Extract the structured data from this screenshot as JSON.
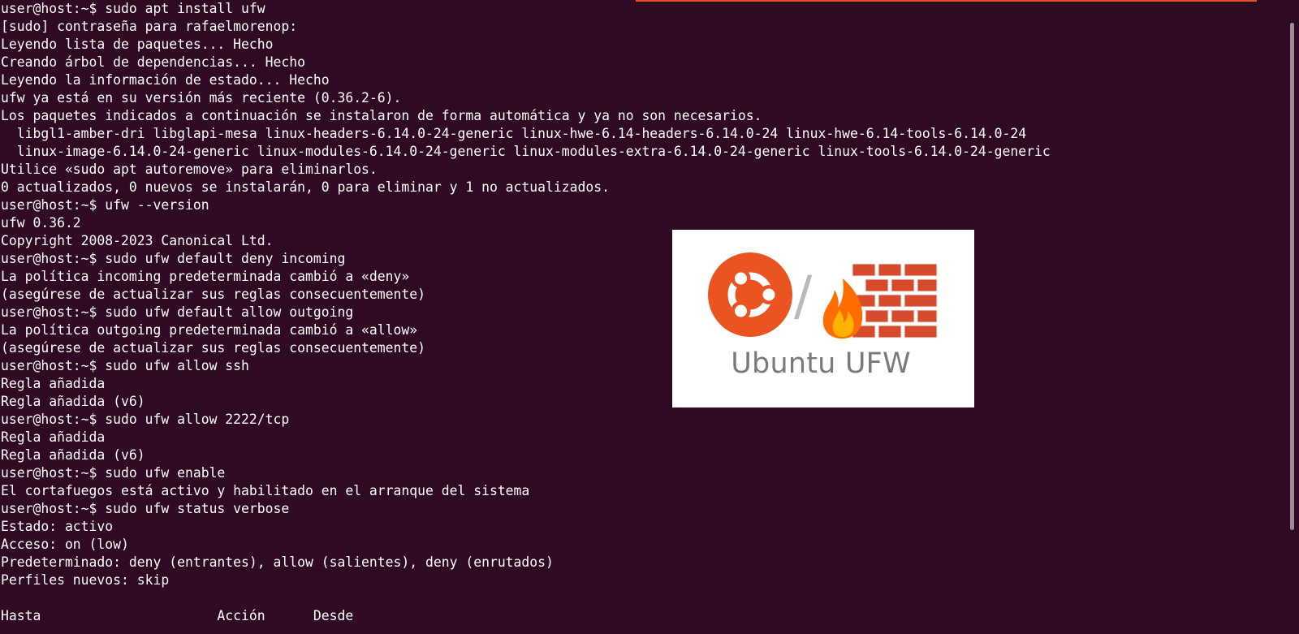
{
  "colors": {
    "terminal_background": "#300a24",
    "terminal_foreground": "#ffffff",
    "top_accent": "#e95420",
    "ubuntu_orange": "#e95420",
    "brick_red": "#d64b2b",
    "brick_mortar": "#eeeeee",
    "flame_orange": "#ff6d00",
    "flame_yellow": "#ffb300",
    "wordmark_gray": "#7b7b7b"
  },
  "terminal": {
    "lines": [
      "user@host:~$ sudo apt install ufw",
      "[sudo] contraseña para rafaelmorenop:",
      "Leyendo lista de paquetes... Hecho",
      "Creando árbol de dependencias... Hecho",
      "Leyendo la información de estado... Hecho",
      "ufw ya está en su versión más reciente (0.36.2-6).",
      "Los paquetes indicados a continuación se instalaron de forma automática y ya no son necesarios.",
      "  libgl1-amber-dri libglapi-mesa linux-headers-6.14.0-24-generic linux-hwe-6.14-headers-6.14.0-24 linux-hwe-6.14-tools-6.14.0-24",
      "  linux-image-6.14.0-24-generic linux-modules-6.14.0-24-generic linux-modules-extra-6.14.0-24-generic linux-tools-6.14.0-24-generic",
      "Utilice «sudo apt autoremove» para eliminarlos.",
      "0 actualizados, 0 nuevos se instalarán, 0 para eliminar y 1 no actualizados.",
      "user@host:~$ ufw --version",
      "ufw 0.36.2",
      "Copyright 2008-2023 Canonical Ltd.",
      "user@host:~$ sudo ufw default deny incoming",
      "La política incoming predeterminada cambió a «deny»",
      "(asegúrese de actualizar sus reglas consecuentemente)",
      "user@host:~$ sudo ufw default allow outgoing",
      "La política outgoing predeterminada cambió a «allow»",
      "(asegúrese de actualizar sus reglas consecuentemente)",
      "user@host:~$ sudo ufw allow ssh",
      "Regla añadida",
      "Regla añadida (v6)",
      "user@host:~$ sudo ufw allow 2222/tcp",
      "Regla añadida",
      "Regla añadida (v6)",
      "user@host:~$ sudo ufw enable",
      "El cortafuegos está activo y habilitado en el arranque del sistema",
      "user@host:~$ sudo ufw status verbose",
      "Estado: activo",
      "Acceso: on (low)",
      "Predeterminado: deny (entrantes), allow (salientes), deny (enrutados)",
      "Perfiles nuevos: skip",
      "",
      "Hasta                      Acción      Desde"
    ]
  },
  "overlay": {
    "product_name": "Ubuntu UFW",
    "logo_icon": "ubuntu-logo-icon",
    "separator": "/",
    "firewall_icon": "firewall-icon"
  }
}
